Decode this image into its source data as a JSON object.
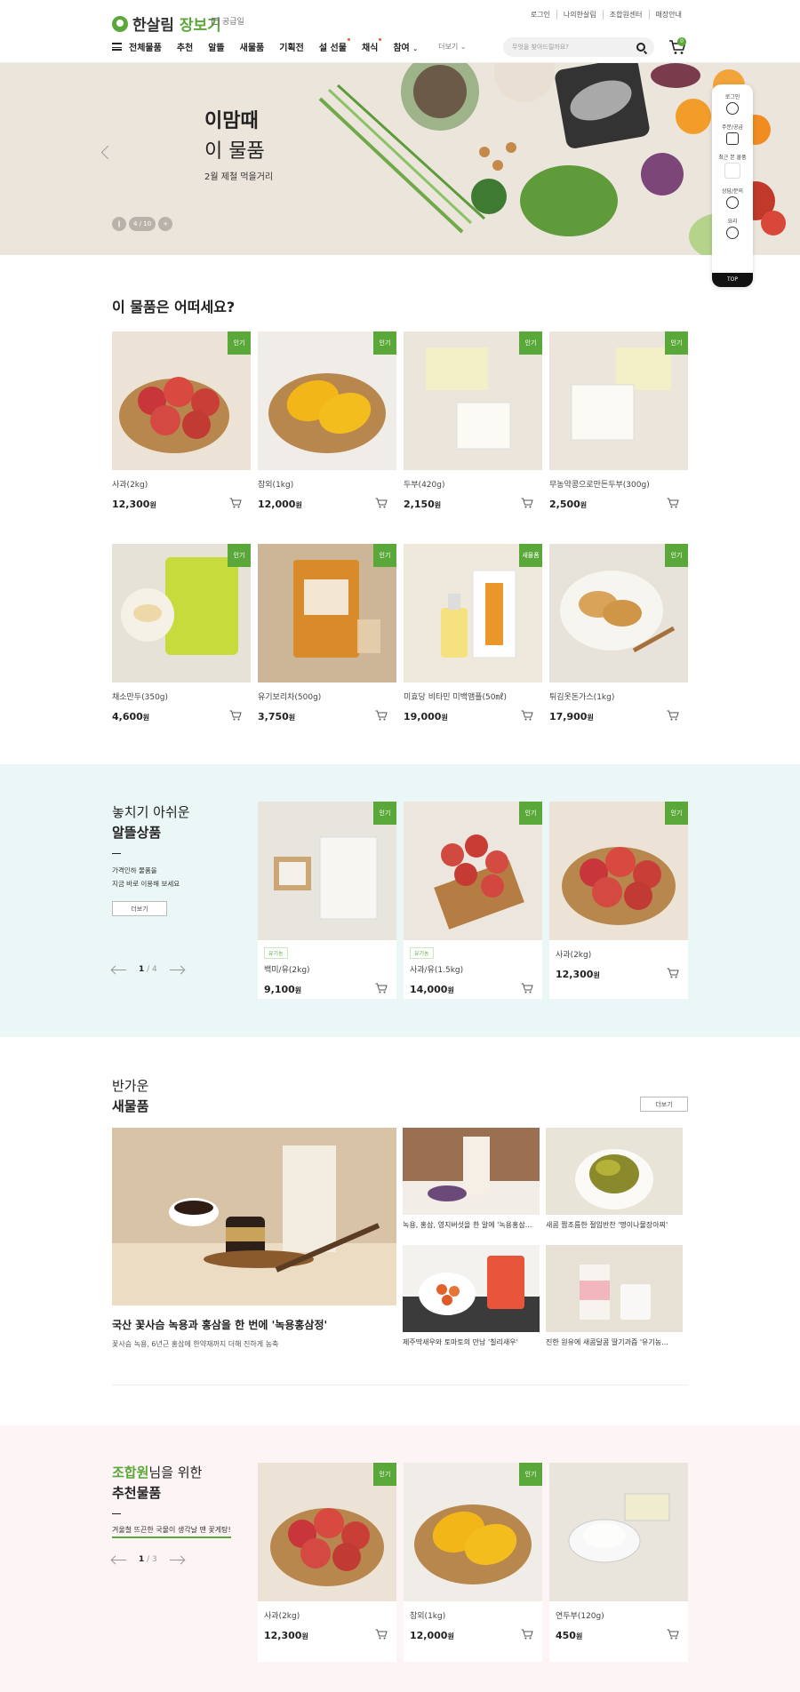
{
  "header": {
    "logo_main": "한살림",
    "logo_accent": "장보기",
    "sub_link": "공급일",
    "util": [
      "로그인",
      "나의한살림",
      "조합원센터",
      "매장안내"
    ],
    "nav": [
      "전체물품",
      "추천",
      "알뜰",
      "새물품",
      "기획전",
      "설 선물",
      "채식",
      "참여"
    ],
    "nav_more": "더보기",
    "search_placeholder": "무엇을 찾아드릴까요?",
    "cart_count": "0"
  },
  "banner": {
    "title1": "이맘때",
    "title2": "이 물품",
    "subtitle": "2월 제철 먹을거리",
    "page": "4 / 10"
  },
  "quick_menu": {
    "items": [
      "로그인",
      "주문/공급",
      "최근 본 물품",
      "상담/문의",
      "요리"
    ],
    "top": "TOP"
  },
  "section1": {
    "title": "이 물품은 어떠세요?",
    "products": [
      {
        "badge": "인기",
        "name": "사과(2kg)",
        "price": "12,300",
        "unit": "원"
      },
      {
        "badge": "인기",
        "name": "참외(1kg)",
        "price": "12,000",
        "unit": "원"
      },
      {
        "badge": "인기",
        "name": "두부(420g)",
        "price": "2,150",
        "unit": "원"
      },
      {
        "badge": "인기",
        "name": "무농약콩으로만든두부(300g)",
        "price": "2,500",
        "unit": "원"
      },
      {
        "badge": "인기",
        "name": "채소만두(350g)",
        "price": "4,600",
        "unit": "원"
      },
      {
        "badge": "인기",
        "name": "유기보리차(500g)",
        "price": "3,750",
        "unit": "원"
      },
      {
        "badge": "새물품",
        "name": "미효당 비타민 미백앰플(50㎖)",
        "price": "19,000",
        "unit": "원"
      },
      {
        "badge": "인기",
        "name": "튀김옷돈가스(1kg)",
        "price": "17,900",
        "unit": "원"
      }
    ]
  },
  "section2": {
    "title1": "놓치기 아쉬운",
    "title2": "알뜰상품",
    "desc1": "가격인하 물품을",
    "desc2": "지금 바로 이용해 보세요",
    "more": "더보기",
    "page_current": "1",
    "page_total": "/ 4",
    "products": [
      {
        "badge": "인기",
        "tag": "유기농",
        "name": "백미/유(2kg)",
        "price": "9,100",
        "unit": "원"
      },
      {
        "badge": "인기",
        "tag": "유기농",
        "name": "사과/유(1.5kg)",
        "price": "14,000",
        "unit": "원"
      },
      {
        "badge": "인기",
        "tag": "",
        "name": "사과(2kg)",
        "price": "12,300",
        "unit": "원"
      }
    ]
  },
  "section3": {
    "title1": "반가운",
    "title2": "새물품",
    "more": "더보기",
    "main_title": "국산 꽃사슴 녹용과 홍삼을 한 번에 '녹용홍삼정'",
    "main_desc": "꽃사슴 녹용, 6년근 홍삼에 한약재까지 더해 진하게 농축",
    "items": [
      "녹용, 홍삼, 영지버섯을 한 알에 '녹용홍삼...",
      "새콤 짭조름한 절임반찬 '명이나물장아찌'",
      "제주딱새우와 토마토의 만남 '칠리새우'",
      "진한 원유에 새콤달콤 딸기과즙 '유기농..."
    ]
  },
  "section4": {
    "title_accent": "조합원",
    "title_rest": "님을 위한",
    "title2": "추천물품",
    "desc": "겨울철 뜨끈한 국물이 생각날 땐 꽃게탕!",
    "page_current": "1",
    "page_total": "/ 3",
    "products": [
      {
        "badge": "인기",
        "name": "사과(2kg)",
        "price": "12,300",
        "unit": "원"
      },
      {
        "badge": "인기",
        "name": "참외(1kg)",
        "price": "12,000",
        "unit": "원"
      },
      {
        "badge": "",
        "name": "연두부(120g)",
        "price": "450",
        "unit": "원"
      }
    ]
  },
  "colors": {
    "brand": "#5aa839",
    "mint_bg": "#eaf7f6",
    "pink_bg": "#fdf4f5"
  }
}
